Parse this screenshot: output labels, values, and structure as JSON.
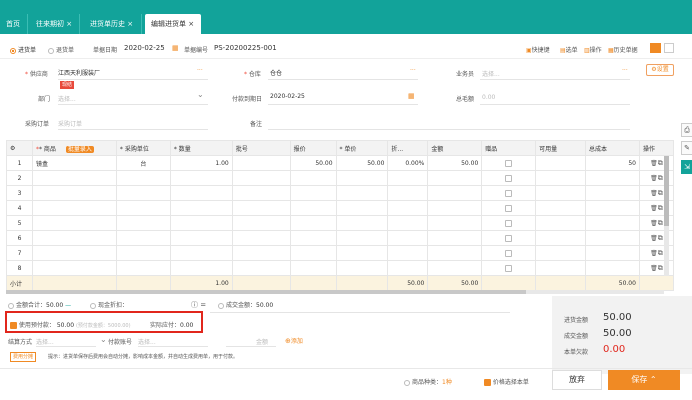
{
  "tabs": [
    {
      "label": "首页"
    },
    {
      "label": "往来期初 ×"
    },
    {
      "label": "进货单历史 ×"
    },
    {
      "label": "编辑进货单 ×"
    }
  ],
  "doc_types": {
    "purchase": "进货单",
    "return": "退货单"
  },
  "header": {
    "date_label": "单据日期",
    "date_value": "2020-02-25",
    "no_label": "单据编号",
    "no_value": "PS-20200225-001",
    "actions": [
      "快捷键",
      "选单",
      "操作",
      "历史单据"
    ]
  },
  "form": {
    "supplier_label": "供应商",
    "supplier_value": "江西天利服装厂",
    "supplier_tag": "现结",
    "warehouse_label": "仓库",
    "warehouse_value": "仓仓",
    "clerk_label": "业务员",
    "clerk_ph": "选择...",
    "settings": "设置",
    "dept_label": "部门",
    "dept_ph": "选择...",
    "due_label": "付款到期日",
    "due_value": "2020-02-25",
    "total_label": "总毛额",
    "total_value": "0.00",
    "po_label": "采购订单",
    "po_ph": "采购订单",
    "remark_label": "备注"
  },
  "table": {
    "headers": [
      "",
      "* 商品",
      "* 采购单位",
      "* 数量",
      "批号",
      "报价",
      "* 单价",
      "折...",
      "金额",
      "赠品",
      "可用量",
      "总成本",
      "操作"
    ],
    "batch_btn": "批量录入",
    "rows": [
      {
        "no": "1",
        "product": "镜盒",
        "unit": "台",
        "qty": "1.00",
        "quote": "50.00",
        "price": "50.00",
        "disc": "0.00%",
        "amount": "50.00",
        "cost": "50"
      },
      {
        "no": "2"
      },
      {
        "no": "3"
      },
      {
        "no": "4"
      },
      {
        "no": "5"
      },
      {
        "no": "6"
      },
      {
        "no": "7"
      },
      {
        "no": "8"
      }
    ],
    "sum": {
      "label": "小计",
      "qty": "1.00",
      "amount1": "50.00",
      "amount2": "50.00",
      "cost": "50.00"
    }
  },
  "footer": {
    "amount_total_label": "金额合计：",
    "amount_total": "50.00",
    "cash_discount_label": "现金折扣：",
    "deal_amount_label": "成交金额：",
    "deal_amount": "50.00",
    "prepay_label": "使用预付款：",
    "prepay_value": "50.00",
    "prepay_note": "(预付款金额：5000.00)",
    "actual_pay_label": "实际应付：",
    "actual_pay": "0.00",
    "settle_label": "结算方式",
    "settle_ph": "选择...",
    "account_label": "付款账号",
    "account_ph": "选择...",
    "amount_ph": "金额",
    "add": "添加",
    "tip_tag": "费用分摊",
    "tip": "提示：进货单保存后费用会自动分摊，影响成本金额，并自动生成费用单，用于付款。",
    "summary": [
      {
        "label": "进货金额",
        "value": "50.00"
      },
      {
        "label": "成交金额",
        "value": "50.00"
      },
      {
        "label": "本单欠款",
        "value": "0.00"
      }
    ],
    "item_types_label": "商品种类：",
    "item_types": "1种",
    "price_option": "价格选择本单",
    "discard": "放弃",
    "save": "保存 ⌃"
  }
}
